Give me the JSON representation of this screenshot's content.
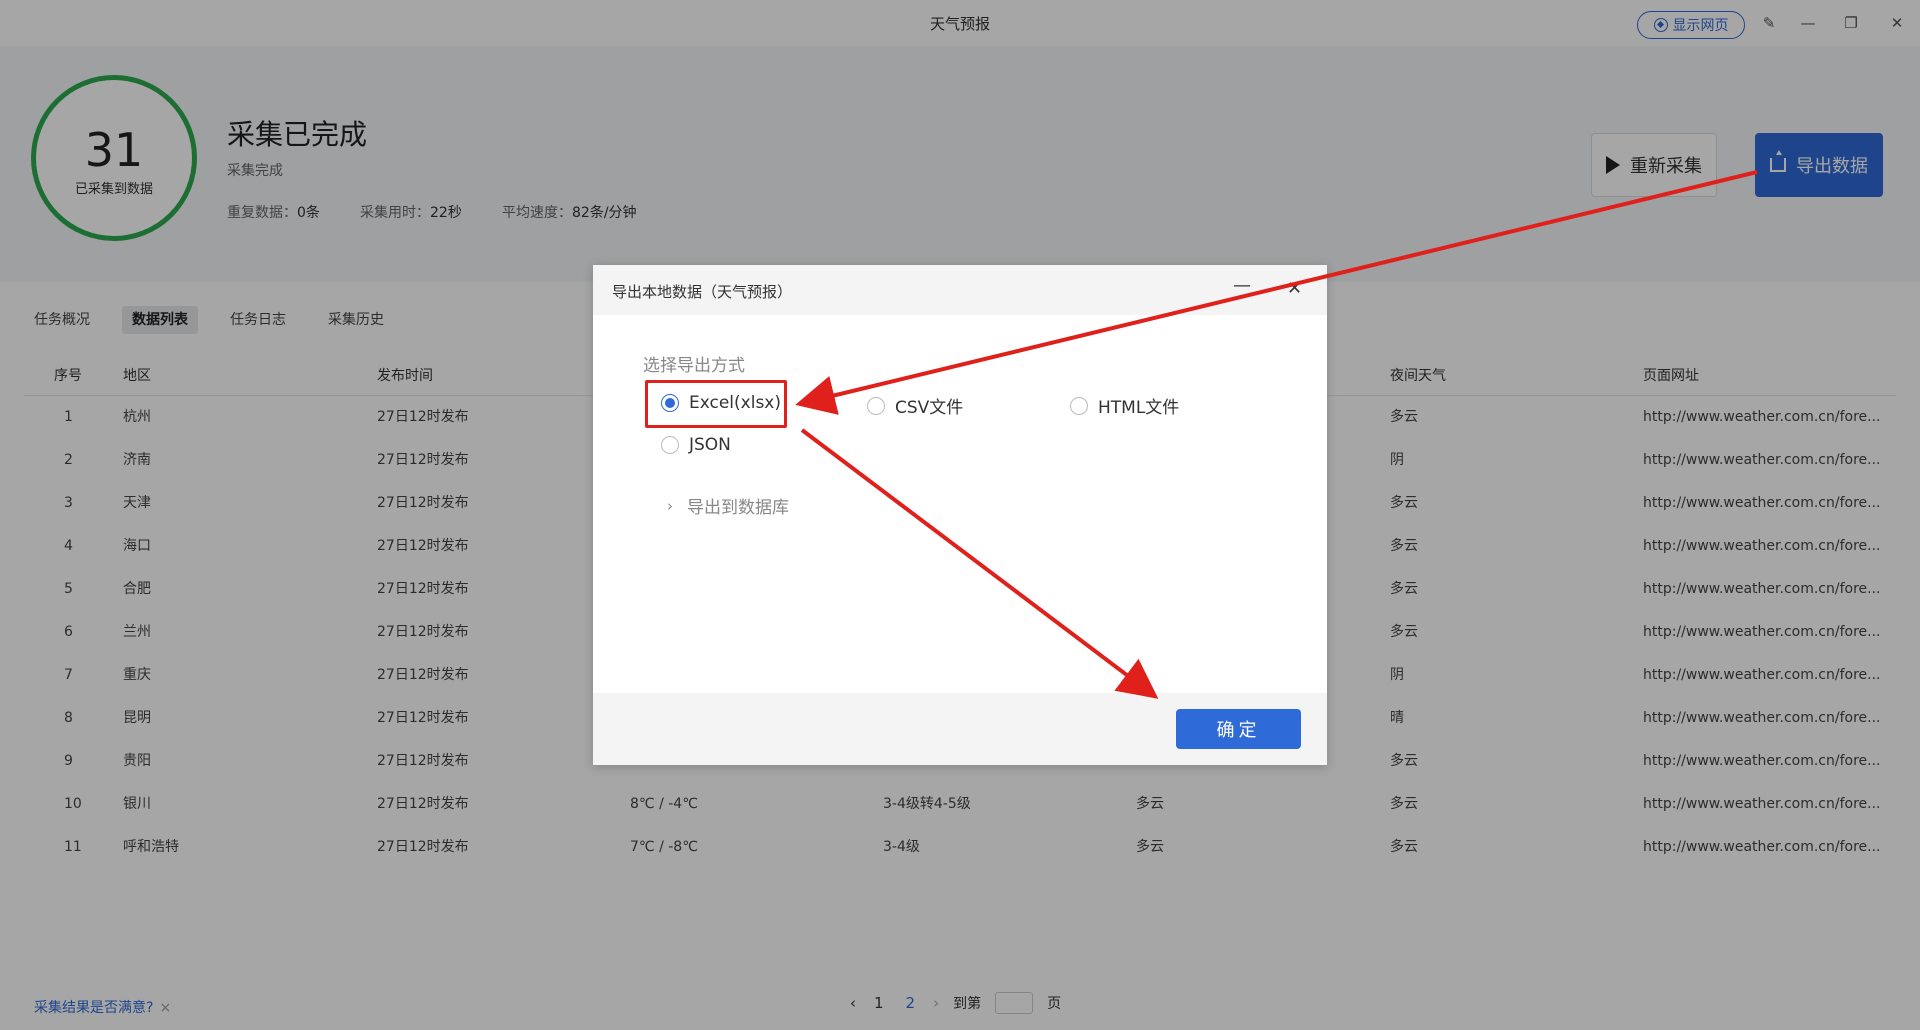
{
  "app": {
    "title": "天气预报",
    "show_web_label": "显示网页",
    "window_controls": [
      "edit-icon",
      "minimize-icon",
      "restore-icon",
      "close-icon"
    ]
  },
  "summary": {
    "count": "31",
    "count_label": "已采集到数据",
    "status_title": "采集已完成",
    "status_sub": "采集完成",
    "duplicates_label": "重复数据：",
    "duplicates_value": "0条",
    "time_label": "采集用时：",
    "time_value": "22秒",
    "speed_label": "平均速度：",
    "speed_value": "82条/分钟",
    "recollect_label": "重新采集",
    "export_label": "导出数据"
  },
  "tabs": [
    "任务概况",
    "数据列表",
    "任务日志",
    "采集历史"
  ],
  "table": {
    "headers": [
      "序号",
      "地区",
      "发布时间",
      "",
      "",
      "",
      "夜间天气",
      "页面网址"
    ],
    "rows": [
      [
        "1",
        "杭州",
        "27日12时发布",
        "",
        "",
        "",
        "多云",
        "http://www.weather.com.cn/fore..."
      ],
      [
        "2",
        "济南",
        "27日12时发布",
        "",
        "",
        "",
        "阴",
        "http://www.weather.com.cn/fore..."
      ],
      [
        "3",
        "天津",
        "27日12时发布",
        "",
        "",
        "",
        "多云",
        "http://www.weather.com.cn/fore..."
      ],
      [
        "4",
        "海口",
        "27日12时发布",
        "",
        "",
        "",
        "多云",
        "http://www.weather.com.cn/fore..."
      ],
      [
        "5",
        "合肥",
        "27日12时发布",
        "",
        "",
        "",
        "多云",
        "http://www.weather.com.cn/fore..."
      ],
      [
        "6",
        "兰州",
        "27日12时发布",
        "",
        "",
        "",
        "多云",
        "http://www.weather.com.cn/fore..."
      ],
      [
        "7",
        "重庆",
        "27日12时发布",
        "",
        "",
        "",
        "阴",
        "http://www.weather.com.cn/fore..."
      ],
      [
        "8",
        "昆明",
        "27日12时发布",
        "",
        "",
        "",
        "晴",
        "http://www.weather.com.cn/fore..."
      ],
      [
        "9",
        "贵阳",
        "27日12时发布",
        "",
        "",
        "",
        "多云",
        "http://www.weather.com.cn/fore..."
      ],
      [
        "10",
        "银川",
        "27日12时发布",
        "8℃ / -4℃",
        "3-4级转4-5级",
        "多云",
        "多云",
        "http://www.weather.com.cn/fore..."
      ],
      [
        "11",
        "呼和浩特",
        "27日12时发布",
        "7℃ / -8℃",
        "3-4级",
        "多云",
        "多云",
        "http://www.weather.com.cn/fore..."
      ]
    ]
  },
  "footer": {
    "feedback": "采集结果是否满意?",
    "feedback_close": "×",
    "pages": [
      "1",
      "2"
    ],
    "current_page": "2",
    "goto_label": "到第",
    "page_unit": "页"
  },
  "modal": {
    "title": "导出本地数据（天气预报）",
    "section_label": "选择导出方式",
    "options": [
      {
        "label": "Excel(xlsx)",
        "checked": true
      },
      {
        "label": "CSV文件",
        "checked": false
      },
      {
        "label": "HTML文件",
        "checked": false
      },
      {
        "label": "JSON",
        "checked": false
      }
    ],
    "db_export_label": "导出到数据库",
    "confirm_label": "确定"
  },
  "colors": {
    "accent": "#2f6bd8",
    "success_ring": "#2da94f",
    "annotation_red": "#e0201b"
  }
}
